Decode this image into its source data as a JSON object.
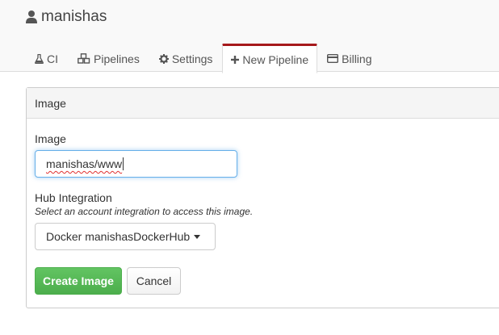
{
  "account": {
    "name": "manishas",
    "icon": "user-icon"
  },
  "tabs": [
    {
      "label": "CI",
      "icon": "flask-icon",
      "active": false
    },
    {
      "label": "Pipelines",
      "icon": "cubes-icon",
      "active": false
    },
    {
      "label": "Settings",
      "icon": "gear-icon",
      "active": false
    },
    {
      "label": "New Pipeline",
      "icon": "plus-icon",
      "active": true
    },
    {
      "label": "Billing",
      "icon": "credit-card-icon",
      "active": false
    }
  ],
  "panel": {
    "heading": "Image",
    "image_label": "Image",
    "image_value": "manishas/www",
    "hub_label": "Hub Integration",
    "hub_help": "Select an account integration to access this image.",
    "hub_selected": "Docker manishasDockerHub",
    "create_label": "Create Image",
    "cancel_label": "Cancel"
  },
  "colors": {
    "active_tab_accent": "#a6191c",
    "primary_button": "#5cb85c",
    "focus_border": "#66afe9"
  }
}
